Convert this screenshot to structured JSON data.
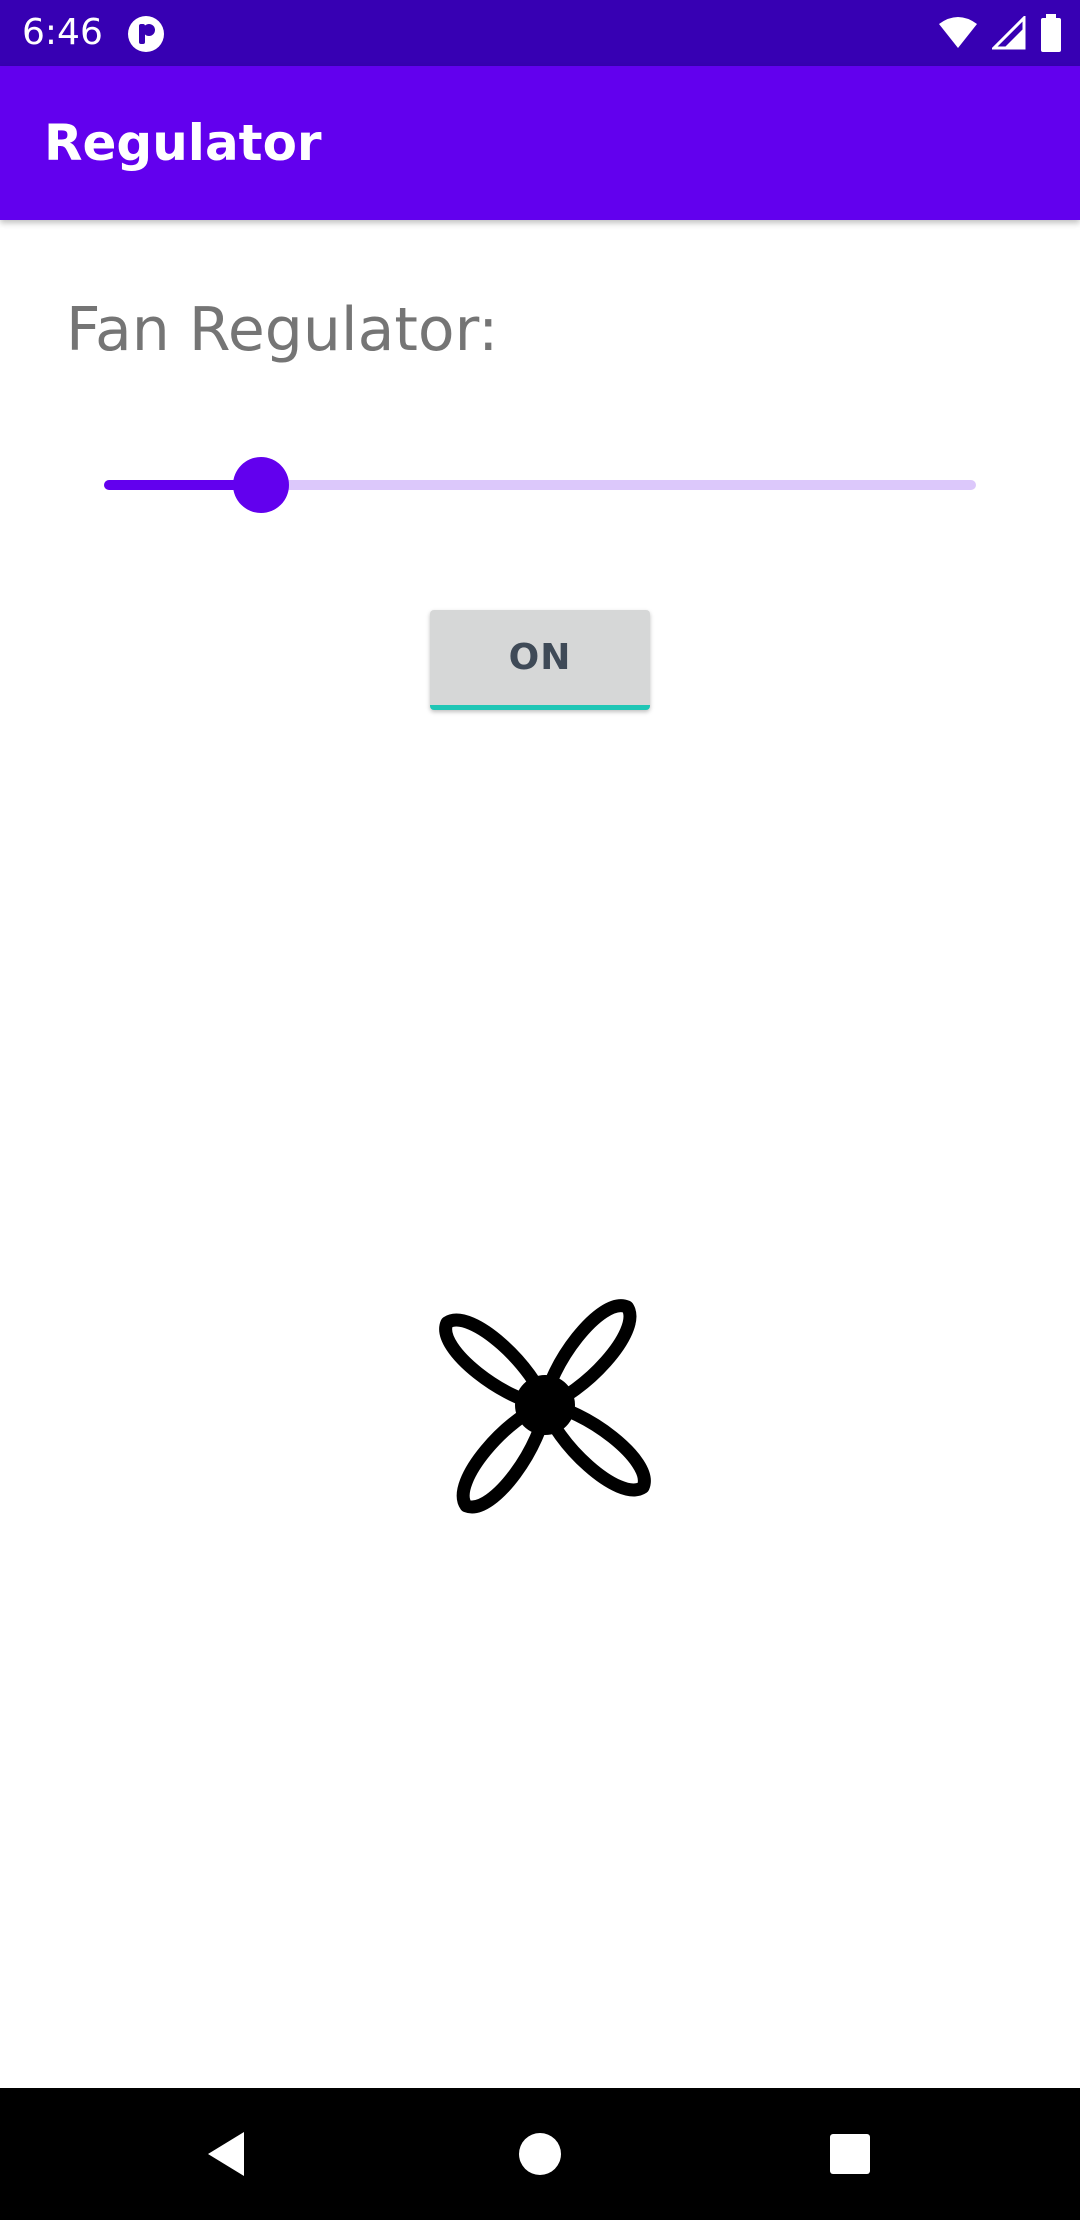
{
  "status_bar": {
    "time": "6:46",
    "icons": [
      "app-notification-icon",
      "wifi-icon",
      "cell-signal-icon",
      "battery-icon"
    ]
  },
  "app_bar": {
    "title": "Regulator",
    "color": "#6200ee"
  },
  "regulator": {
    "label": "Fan Regulator:",
    "slider_value_fraction": 0.18,
    "accent_color": "#6200ee",
    "track_color": "#dcc8fb"
  },
  "toggle_button": {
    "label": "ON",
    "underline_color": "#1fc6b5"
  },
  "fan": {
    "icon": "fan-icon"
  },
  "nav_bar": {
    "icons": [
      "back-icon",
      "home-icon",
      "recents-icon"
    ]
  }
}
